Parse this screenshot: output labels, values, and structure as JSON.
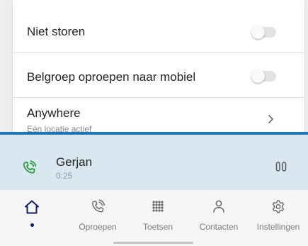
{
  "settings": {
    "rows": [
      {
        "label": "Niet storen",
        "toggle_on": false
      },
      {
        "label": "Belgroep oproepen naar mobiel",
        "toggle_on": false
      },
      {
        "label": "Anywhere",
        "sublabel": "Eén locatie actief"
      }
    ]
  },
  "call": {
    "caller": "Gerjan",
    "duration": "0:25"
  },
  "nav": {
    "items": [
      {
        "label": "",
        "icon": "home-icon",
        "active": true
      },
      {
        "label": "Oproepen",
        "icon": "calls-icon",
        "active": false
      },
      {
        "label": "Toetsen",
        "icon": "dialpad-icon",
        "active": false
      },
      {
        "label": "Contacten",
        "icon": "contacts-icon",
        "active": false
      },
      {
        "label": "Instellingen",
        "icon": "settings-icon",
        "active": false
      }
    ]
  },
  "colors": {
    "accent": "#1d74b6",
    "call_bar_bg": "#d9e7f1",
    "call_icon": "#2a9a3a",
    "nav_active": "#0d1d73"
  }
}
